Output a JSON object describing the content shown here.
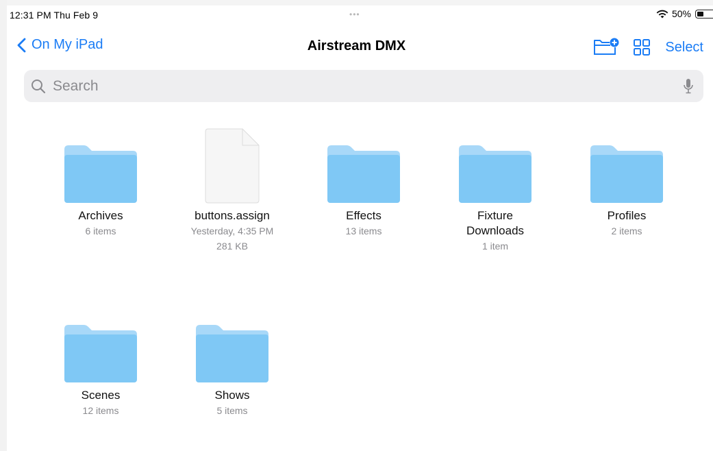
{
  "status_bar": {
    "time": "12:31 PM  Thu Feb 9",
    "dots": "•••",
    "battery": "50%"
  },
  "nav": {
    "back_label": "On My iPad",
    "title": "Airstream DMX",
    "select_label": "Select"
  },
  "search": {
    "placeholder": "Search"
  },
  "colors": {
    "accent": "#1a7cf5",
    "folder": "#7fc8f5",
    "folder_tab": "#a8d8f8"
  },
  "items": [
    {
      "name": "Archives",
      "meta": [
        "6 items"
      ],
      "kind": "folder"
    },
    {
      "name": "buttons.assign",
      "meta": [
        "Yesterday, 4:35 PM",
        "281 KB"
      ],
      "kind": "file"
    },
    {
      "name": "Effects",
      "meta": [
        "13 items"
      ],
      "kind": "folder"
    },
    {
      "name": "Fixture\nDownloads",
      "meta": [
        "1 item"
      ],
      "kind": "folder"
    },
    {
      "name": "Profiles",
      "meta": [
        "2 items"
      ],
      "kind": "folder"
    },
    {
      "name": "Scenes",
      "meta": [
        "12 items"
      ],
      "kind": "folder"
    },
    {
      "name": "Shows",
      "meta": [
        "5 items"
      ],
      "kind": "folder"
    }
  ]
}
